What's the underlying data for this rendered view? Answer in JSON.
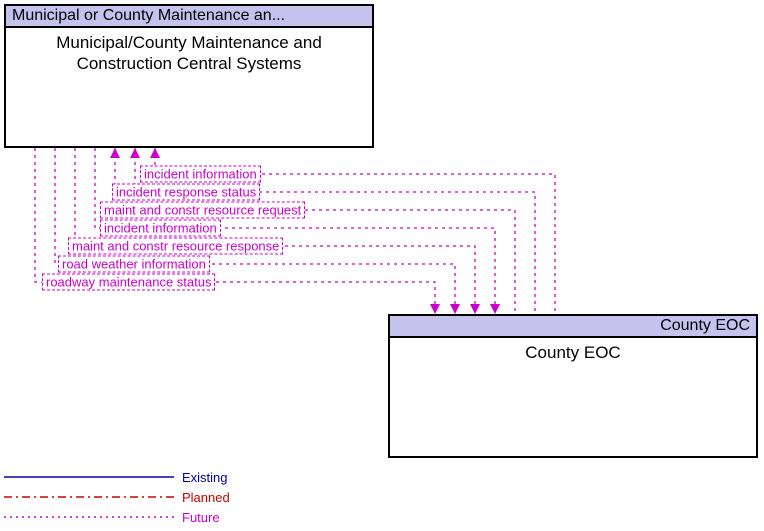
{
  "nodes": {
    "municipal": {
      "header": "Municipal or County Maintenance an...",
      "body": "Municipal/County Maintenance and Construction Central Systems"
    },
    "eoc": {
      "header": "County EOC",
      "body": "County EOC"
    }
  },
  "flows": {
    "f0": "incident information",
    "f1": "incident response status",
    "f2": "maint and constr resource request",
    "f3": "incident information",
    "f4": "maint and constr resource response",
    "f5": "road weather information",
    "f6": "roadway maintenance status"
  },
  "legend": {
    "existing": "Existing",
    "planned": "Planned",
    "future": "Future"
  },
  "chart_data": {
    "type": "diagram",
    "description": "ITS architecture interconnect diagram between two system nodes with directional information flows, all of status 'Future'.",
    "nodes": [
      {
        "id": "municipal",
        "stakeholder": "Municipal or County Maintenance an...",
        "element": "Municipal/County Maintenance and Construction Central Systems"
      },
      {
        "id": "eoc",
        "stakeholder": "County EOC",
        "element": "County EOC"
      }
    ],
    "flows": [
      {
        "label": "incident information",
        "from": "eoc",
        "to": "municipal",
        "status": "Future"
      },
      {
        "label": "incident response status",
        "from": "eoc",
        "to": "municipal",
        "status": "Future"
      },
      {
        "label": "maint and constr resource request",
        "from": "eoc",
        "to": "municipal",
        "status": "Future"
      },
      {
        "label": "incident information",
        "from": "municipal",
        "to": "eoc",
        "status": "Future"
      },
      {
        "label": "maint and constr resource response",
        "from": "municipal",
        "to": "eoc",
        "status": "Future"
      },
      {
        "label": "road weather information",
        "from": "municipal",
        "to": "eoc",
        "status": "Future"
      },
      {
        "label": "roadway maintenance status",
        "from": "municipal",
        "to": "eoc",
        "status": "Future"
      }
    ],
    "legend_statuses": [
      "Existing",
      "Planned",
      "Future"
    ]
  }
}
